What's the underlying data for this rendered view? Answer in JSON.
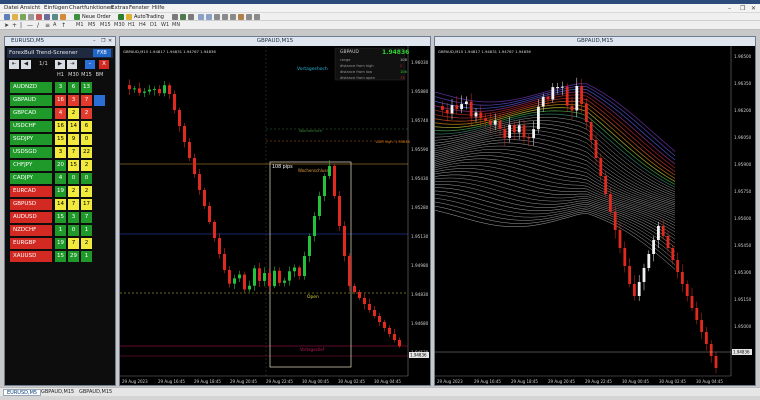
{
  "title": "",
  "menu": [
    "Datei",
    "Ansicht",
    "Einfügen",
    "Chartfunktionen",
    "Extras",
    "Fenster",
    "Hilfe"
  ],
  "toolbar": {
    "new_order": "Neue Order",
    "autotrading": "AutoTrading",
    "timeframes": [
      "M1",
      "M5",
      "M15",
      "M30",
      "H1",
      "H4",
      "D1",
      "W1",
      "MN"
    ]
  },
  "screener": {
    "window_title": "EURUSD,M5",
    "header": "ForexBull Trend-Screener",
    "fxb_button": "FXB",
    "page": "1/1",
    "close_label": "X",
    "columns": [
      "H1",
      "M30",
      "M15",
      "BM"
    ],
    "rows": [
      {
        "sym": "AUDNZD",
        "sym_color": "#1f9a2a",
        "vals": [
          "3",
          "6",
          "13"
        ],
        "cols": [
          "#1f9a2a",
          "#1f9a2a",
          "#1f9a2a"
        ],
        "bm": ""
      },
      {
        "sym": "GBPAUD",
        "sym_color": "#1f9a2a",
        "vals": [
          "16",
          "3",
          "7"
        ],
        "cols": [
          "#e23b2e",
          "#e23b2e",
          "#e23b2e"
        ],
        "bm": "#2a6fd6"
      },
      {
        "sym": "GBPCAD",
        "sym_color": "#1f9a2a",
        "vals": [
          "4",
          "2",
          "2"
        ],
        "cols": [
          "#e23b2e",
          "#f1ea3c",
          "#e23b2e"
        ],
        "bm": ""
      },
      {
        "sym": "USDCHF",
        "sym_color": "#1f9a2a",
        "vals": [
          "16",
          "14",
          "6"
        ],
        "cols": [
          "#f1ea3c",
          "#f1ea3c",
          "#f1ea3c"
        ],
        "bm": ""
      },
      {
        "sym": "SGDJPY",
        "sym_color": "#1f9a2a",
        "vals": [
          "15",
          "9",
          "0"
        ],
        "cols": [
          "#f1ea3c",
          "#f1ea3c",
          "#f1ea3c"
        ],
        "bm": ""
      },
      {
        "sym": "USDSGD",
        "sym_color": "#1f9a2a",
        "vals": [
          "3",
          "7",
          "22"
        ],
        "cols": [
          "#f1ea3c",
          "#f1ea3c",
          "#f1ea3c"
        ],
        "bm": ""
      },
      {
        "sym": "CHFJPY",
        "sym_color": "#1f9a2a",
        "vals": [
          "20",
          "15",
          "2"
        ],
        "cols": [
          "#1f9a2a",
          "#f1ea3c",
          "#f1ea3c"
        ],
        "bm": ""
      },
      {
        "sym": "CADJPY",
        "sym_color": "#1f9a2a",
        "vals": [
          "4",
          "0",
          "0"
        ],
        "cols": [
          "#1f9a2a",
          "#1f9a2a",
          "#1f9a2a"
        ],
        "bm": ""
      },
      {
        "sym": "EURCAD",
        "sym_color": "#d22a22",
        "vals": [
          "19",
          "2",
          "2"
        ],
        "cols": [
          "#1f9a2a",
          "#f1ea3c",
          "#f1ea3c"
        ],
        "bm": ""
      },
      {
        "sym": "GBPUSD",
        "sym_color": "#d22a22",
        "vals": [
          "14",
          "7",
          "17"
        ],
        "cols": [
          "#f1ea3c",
          "#f1ea3c",
          "#f1ea3c"
        ],
        "bm": ""
      },
      {
        "sym": "AUDUSD",
        "sym_color": "#d22a22",
        "vals": [
          "15",
          "3",
          "7"
        ],
        "cols": [
          "#1f9a2a",
          "#1f9a2a",
          "#1f9a2a"
        ],
        "bm": ""
      },
      {
        "sym": "NZDCHF",
        "sym_color": "#d22a22",
        "vals": [
          "1",
          "0",
          "1"
        ],
        "cols": [
          "#1f9a2a",
          "#1f9a2a",
          "#1f9a2a"
        ],
        "bm": ""
      },
      {
        "sym": "EURGBP",
        "sym_color": "#d22a22",
        "vals": [
          "19",
          "7",
          "2"
        ],
        "cols": [
          "#1f9a2a",
          "#f1ea3c",
          "#f1ea3c"
        ],
        "bm": ""
      },
      {
        "sym": "XAUUSD",
        "sym_color": "#d22a22",
        "vals": [
          "15",
          "29",
          "1"
        ],
        "cols": [
          "#1f9a2a",
          "#1f9a2a",
          "#1f9a2a"
        ],
        "bm": ""
      }
    ]
  },
  "chart1": {
    "window_title": "GBPAUD,M15",
    "symbol_box": "GBPAUD",
    "price_big": "1.94836",
    "info_rows": [
      "range",
      "distance from high",
      "distance from low",
      "distance from open"
    ],
    "info_vals": [
      "108",
      "2",
      "106",
      "73"
    ],
    "labels": {
      "vortageshoch": "Vortageshoch",
      "adr_high": "ADR high: 1.95848",
      "pips": "108 pips",
      "wochenschluss": "Wochenschluss",
      "open": "Open",
      "vortagestief": "Vortagestief",
      "wochenhoch": "Wochenhoch"
    },
    "price_ticks": [
      "1.96030",
      "1.95880",
      "1.95740",
      "1.95590",
      "1.95430",
      "1.95280",
      "1.95130",
      "1.94980",
      "1.94830",
      "1.94680",
      "1.94530"
    ],
    "time_ticks": [
      "29 Aug 2023",
      "29 Aug 16:45",
      "29 Aug 18:45",
      "29 Aug 20:45",
      "29 Aug 22:45",
      "30 Aug 00:45",
      "30 Aug 02:45",
      "30 Aug 04:45"
    ]
  },
  "chart2": {
    "window_title": "GBPAUD,M15",
    "price_ticks": [
      "1.96500",
      "1.96350",
      "1.96200",
      "1.96050",
      "1.95900",
      "1.95750",
      "1.95600",
      "1.95450",
      "1.95300",
      "1.95150",
      "1.95000",
      "1.94850"
    ],
    "time_ticks": [
      "29 Aug 2023",
      "29 Aug 16:45",
      "29 Aug 18:45",
      "29 Aug 20:45",
      "29 Aug 22:45",
      "30 Aug 00:45",
      "30 Aug 02:45",
      "30 Aug 04:45"
    ]
  },
  "tabs": [
    "EURUSD,M5",
    "GBPAUD,M15",
    "GBPAUD,M15"
  ]
}
